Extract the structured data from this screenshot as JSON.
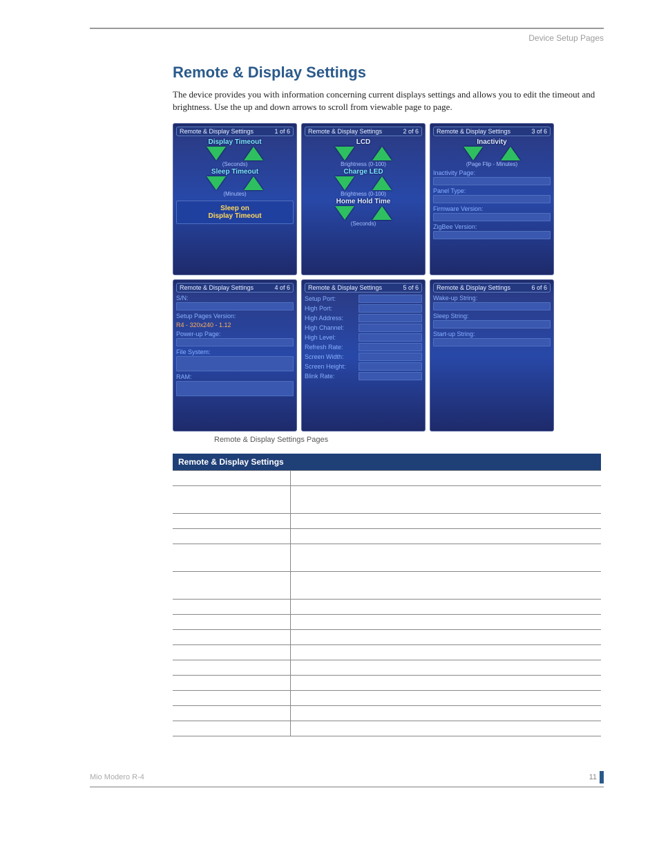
{
  "header": {
    "right": "Device Setup Pages"
  },
  "title": "Remote & Display Settings",
  "body": "The device provides you with information concerning current displays settings and allows you to edit the timeout and brightness. Use the up and down arrows to scroll from viewable page to page.",
  "caption": "Remote & Display Settings Pages",
  "screens": [
    {
      "title": "Remote & Display Settings",
      "page": "1 of 6",
      "sections": [
        {
          "label": "Display Timeout",
          "sub": "(Seconds)"
        },
        {
          "label": "Sleep Timeout",
          "sub": "(Minutes)"
        }
      ],
      "button": "Sleep on\nDisplay Timeout"
    },
    {
      "title": "Remote & Display Settings",
      "page": "2 of 6",
      "sections": [
        {
          "label": "LCD",
          "sub": "Brightness (0-100)"
        },
        {
          "label": "Charge LED",
          "sub": "Brightness (0-100)"
        },
        {
          "label": "Home Hold Time",
          "sub": "(Seconds)"
        }
      ]
    },
    {
      "title": "Remote & Display Settings",
      "page": "3 of 6",
      "sections": [
        {
          "label": "Inactivity",
          "sub": "(Page Flip - Minutes)"
        }
      ],
      "fields": [
        "Inactivity Page:",
        "Panel Type:",
        "Firmware Version:",
        "ZigBee Version:"
      ]
    },
    {
      "title": "Remote & Display Settings",
      "page": "4 of 6",
      "fields_a": [
        {
          "k": "S/N:",
          "v": ""
        },
        {
          "k": "Setup Pages Version:",
          "v": ""
        },
        {
          "k": "",
          "v": "R4 - 320x240 - 1.12",
          "orange": true
        },
        {
          "k": "Power-up Page:",
          "v": ""
        },
        {
          "k": "File System:",
          "v": ""
        },
        {
          "k": "RAM:",
          "v": ""
        }
      ]
    },
    {
      "title": "Remote & Display Settings",
      "page": "5 of 6",
      "fields_b": [
        "Setup Port:",
        "High Port:",
        "High Address:",
        "High Channel:",
        "High Level:",
        "Refresh Rate:",
        "Screen Width:",
        "Screen Height:",
        "Blink Rate:"
      ]
    },
    {
      "title": "Remote & Display Settings",
      "page": "6 of 6",
      "fields_c": [
        "Wake-up String:",
        "Sleep String:",
        "Start-up String:"
      ]
    }
  ],
  "table": {
    "header": "Remote & Display Settings",
    "row_count": 15,
    "tall_rows": [
      1,
      4,
      5
    ]
  },
  "footer": {
    "left": "Mio Modero R-4",
    "page": "11"
  }
}
